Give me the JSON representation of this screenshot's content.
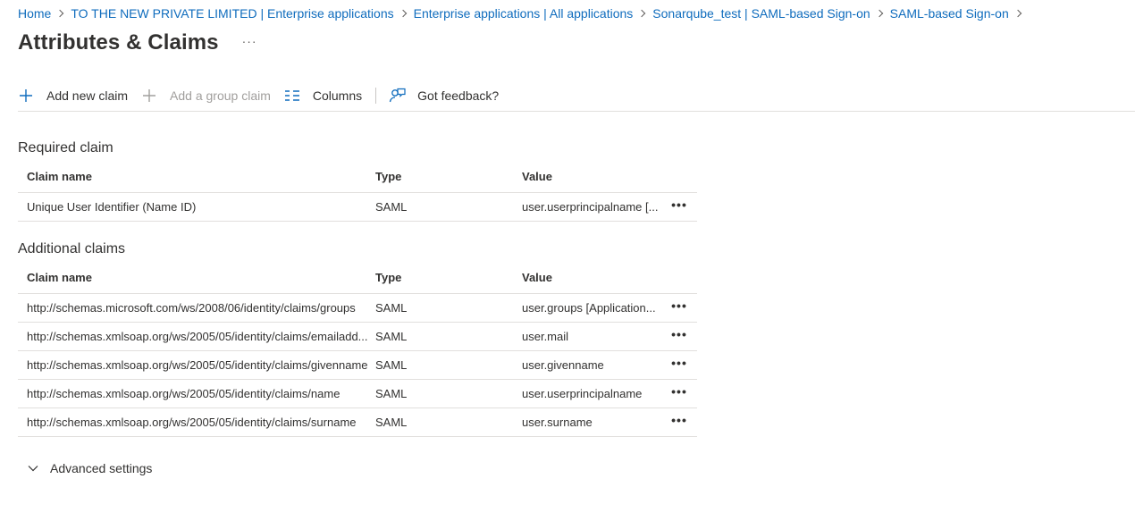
{
  "breadcrumb": [
    {
      "label": "Home"
    },
    {
      "label": "TO THE NEW PRIVATE LIMITED | Enterprise applications"
    },
    {
      "label": "Enterprise applications | All applications"
    },
    {
      "label": "Sonarqube_test | SAML-based Sign-on"
    },
    {
      "label": "SAML-based Sign-on"
    }
  ],
  "page": {
    "title": "Attributes & Claims",
    "more": "···"
  },
  "toolbar": {
    "add_new_claim": "Add new claim",
    "add_group_claim": "Add a group claim",
    "columns": "Columns",
    "feedback": "Got feedback?"
  },
  "columns": {
    "claim_name": "Claim name",
    "type": "Type",
    "value": "Value"
  },
  "required": {
    "title": "Required claim",
    "rows": [
      {
        "name": "Unique User Identifier (Name ID)",
        "type": "SAML",
        "value": "user.userprincipalname [..."
      }
    ]
  },
  "additional": {
    "title": "Additional claims",
    "rows": [
      {
        "name": "http://schemas.microsoft.com/ws/2008/06/identity/claims/groups",
        "type": "SAML",
        "value": "user.groups [Application..."
      },
      {
        "name": "http://schemas.xmlsoap.org/ws/2005/05/identity/claims/emailadd...",
        "type": "SAML",
        "value": "user.mail"
      },
      {
        "name": "http://schemas.xmlsoap.org/ws/2005/05/identity/claims/givenname",
        "type": "SAML",
        "value": "user.givenname"
      },
      {
        "name": "http://schemas.xmlsoap.org/ws/2005/05/identity/claims/name",
        "type": "SAML",
        "value": "user.userprincipalname"
      },
      {
        "name": "http://schemas.xmlsoap.org/ws/2005/05/identity/claims/surname",
        "type": "SAML",
        "value": "user.surname"
      }
    ]
  },
  "row_more": "•••",
  "advanced": {
    "label": "Advanced settings"
  },
  "colors": {
    "link": "#0f6cbd",
    "text": "#323130",
    "divider": "#e1dfdd",
    "disabled": "#a19f9d"
  }
}
